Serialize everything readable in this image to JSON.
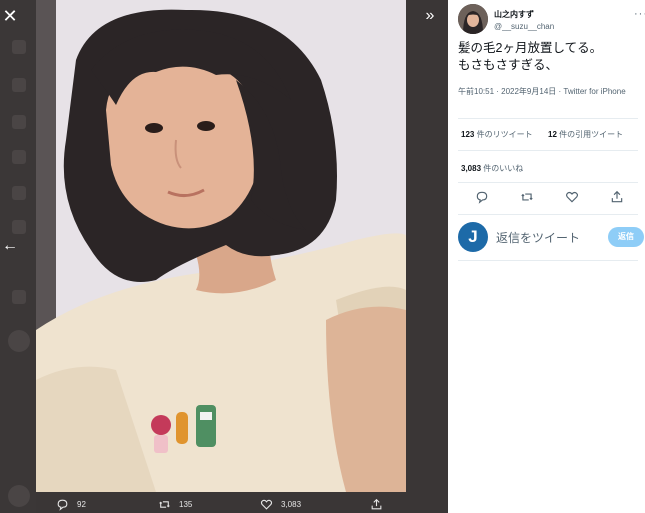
{
  "viewer": {
    "close_glyph": "✕",
    "expand_glyph": "»",
    "prev_glyph": "←",
    "photo_alt": "selfie photo"
  },
  "photo_actions": {
    "replies": "92",
    "retweets": "135",
    "likes": "3,083"
  },
  "tweet": {
    "display_name": "山之内すず",
    "handle": "@__suzu__chan",
    "more_glyph": "···",
    "text_line1": "髪の毛2ヶ月放置してる。",
    "text_line2": "もさもさすぎる、",
    "time_date": "午前10:51 · 2022年9月14日 · ",
    "source": "Twitter for iPhone",
    "retweets_count": "123",
    "retweets_label": " 件のリツイート",
    "quotes_count": "12",
    "quotes_label": " 件の引用ツイート",
    "likes_count": "3,083",
    "likes_label": " 件のいいね"
  },
  "reply": {
    "avatar_letter": "J",
    "placeholder": "返信をツイート",
    "button_label": "返信"
  },
  "colors": {
    "accent": "#1d9bf0",
    "reply_button": "#8ecdf7",
    "backdrop": "#3a3636"
  },
  "icons": [
    "close-icon",
    "expand-icon",
    "back-arrow-icon",
    "reply-icon",
    "retweet-icon",
    "like-icon",
    "share-icon",
    "more-icon"
  ]
}
